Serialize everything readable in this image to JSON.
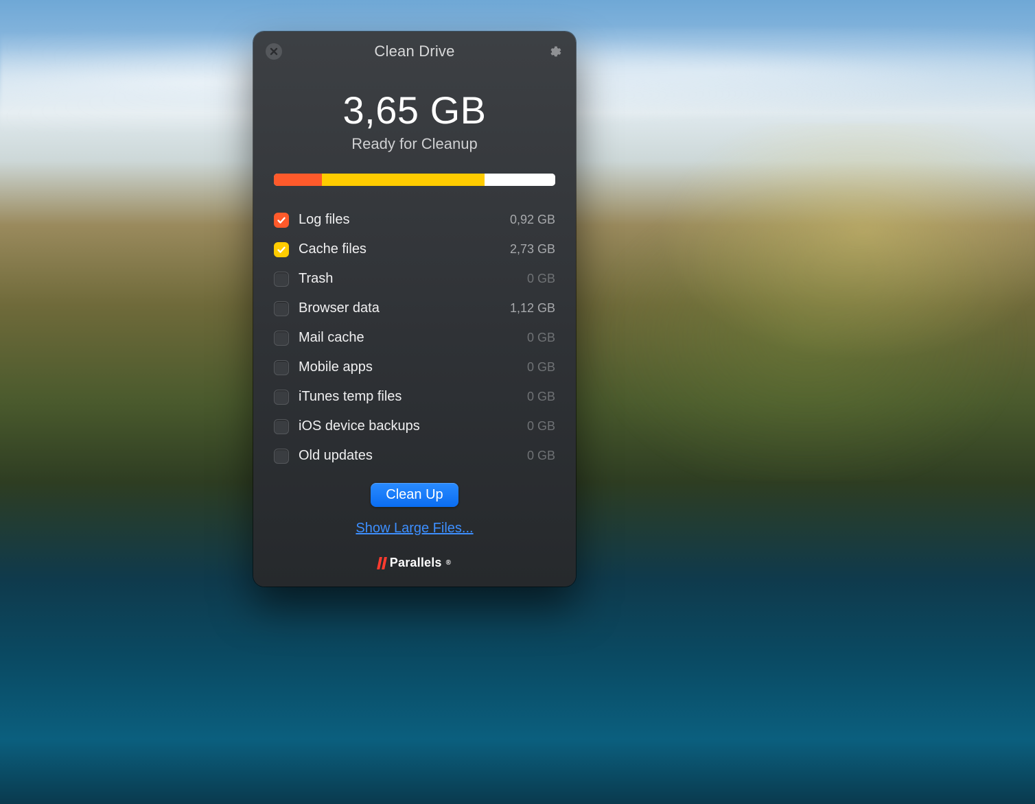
{
  "window": {
    "title": "Clean Drive"
  },
  "summary": {
    "total": "3,65 GB",
    "subtitle": "Ready for Cleanup"
  },
  "bar": {
    "segments": [
      {
        "color": "#ff5a2b",
        "widthPct": 17
      },
      {
        "color": "#ffcc00",
        "widthPct": 58
      },
      {
        "color": "#ffffff",
        "widthPct": 25
      }
    ]
  },
  "categories": [
    {
      "id": "log-files",
      "label": "Log files",
      "size": "0,92 GB",
      "checked": true,
      "color": "#ff5a2b",
      "zero": false
    },
    {
      "id": "cache-files",
      "label": "Cache files",
      "size": "2,73 GB",
      "checked": true,
      "color": "#ffcc00",
      "zero": false
    },
    {
      "id": "trash",
      "label": "Trash",
      "size": "0 GB",
      "checked": false,
      "color": "",
      "zero": true
    },
    {
      "id": "browser-data",
      "label": "Browser data",
      "size": "1,12 GB",
      "checked": false,
      "color": "",
      "zero": false
    },
    {
      "id": "mail-cache",
      "label": "Mail cache",
      "size": "0 GB",
      "checked": false,
      "color": "",
      "zero": true
    },
    {
      "id": "mobile-apps",
      "label": "Mobile apps",
      "size": "0 GB",
      "checked": false,
      "color": "",
      "zero": true
    },
    {
      "id": "itunes-temp",
      "label": "iTunes temp files",
      "size": "0 GB",
      "checked": false,
      "color": "",
      "zero": true
    },
    {
      "id": "ios-backups",
      "label": "iOS device backups",
      "size": "0 GB",
      "checked": false,
      "color": "",
      "zero": true
    },
    {
      "id": "old-updates",
      "label": "Old updates",
      "size": "0 GB",
      "checked": false,
      "color": "",
      "zero": true
    }
  ],
  "actions": {
    "cleanup_label": "Clean Up",
    "large_files_link": "Show Large Files..."
  },
  "brand": {
    "name": "Parallels",
    "mark": "®"
  }
}
